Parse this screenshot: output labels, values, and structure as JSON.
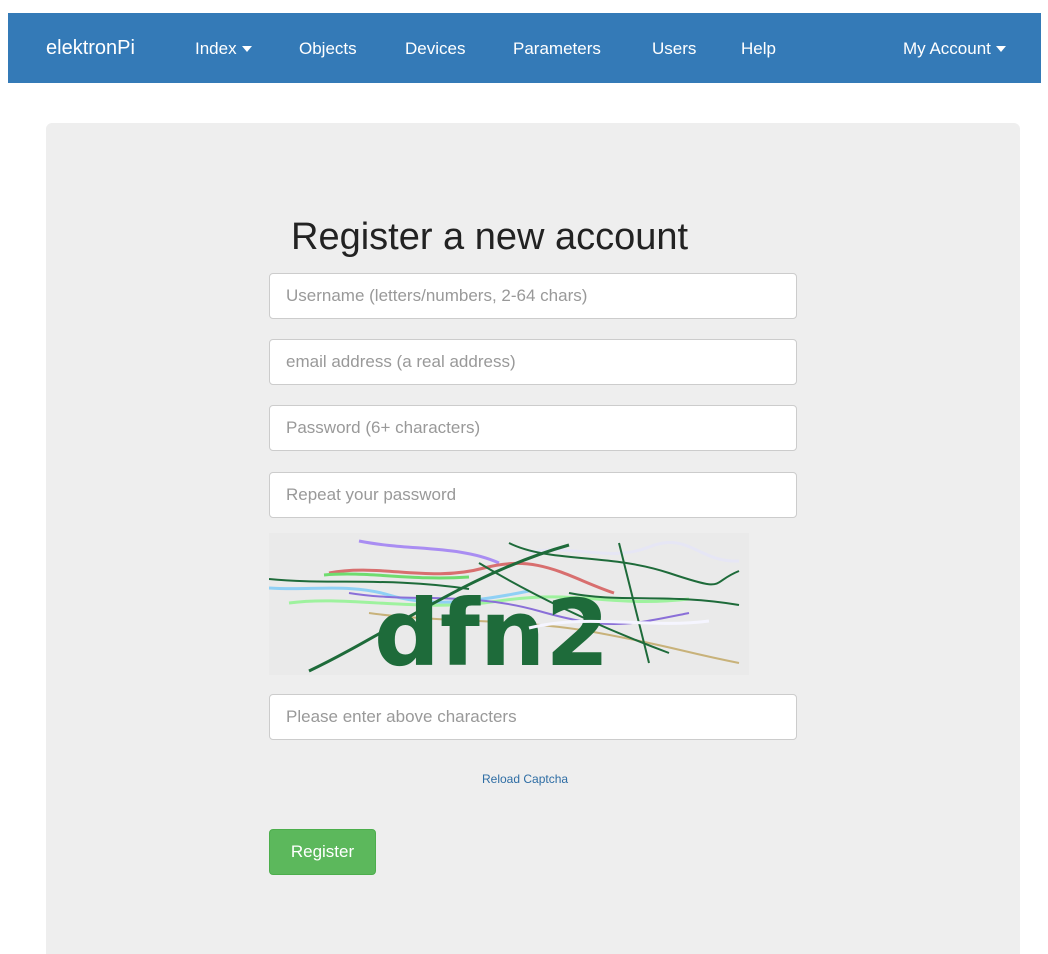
{
  "navbar": {
    "brand": "elektronPi",
    "items": [
      {
        "label": "Index",
        "dropdown": true
      },
      {
        "label": "Objects"
      },
      {
        "label": "Devices"
      },
      {
        "label": "Parameters"
      },
      {
        "label": "Users"
      },
      {
        "label": "Help"
      }
    ],
    "account": {
      "label": "My Account",
      "dropdown": true
    }
  },
  "form": {
    "title": "Register a new account",
    "username_placeholder": "Username (letters/numbers, 2-64 chars)",
    "email_placeholder": "email address (a real address)",
    "password_placeholder": "Password (6+ characters)",
    "repeat_password_placeholder": "Repeat your password",
    "captcha_text": "dfn2",
    "captcha_placeholder": "Please enter above characters",
    "reload_captcha_label": "Reload Captcha",
    "register_label": "Register"
  },
  "colors": {
    "navbar_bg": "#347ab7",
    "jumbotron_bg": "#eeeeee",
    "register_button": "#5cb85c",
    "link": "#2e6da4",
    "captcha_text": "#1e6b3a"
  }
}
